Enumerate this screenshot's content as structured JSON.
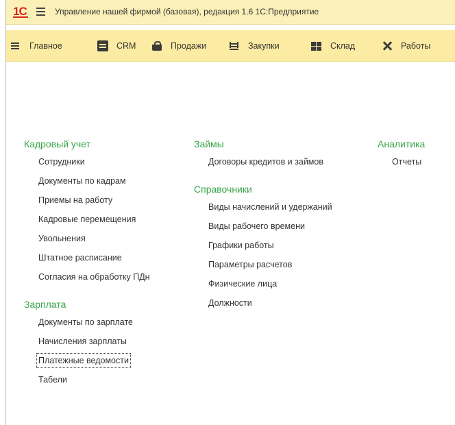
{
  "titlebar": {
    "logo": "1С",
    "title": "Управление нашей фирмой (базовая), редакция 1.6 1С:Предприятие"
  },
  "sections": [
    {
      "label": "Главное",
      "icon": "menu-icon"
    },
    {
      "label": "CRM",
      "icon": "crm-icon"
    },
    {
      "label": "Продажи",
      "icon": "basket-icon"
    },
    {
      "label": "Закупки",
      "icon": "truck-icon"
    },
    {
      "label": "Склад",
      "icon": "warehouse-icon"
    },
    {
      "label": "Работы",
      "icon": "tools-icon"
    }
  ],
  "columns": [
    {
      "groups": [
        {
          "title": "Кадровый учет",
          "items": [
            "Сотрудники",
            "Документы по кадрам",
            "Приемы на работу",
            "Кадровые перемещения",
            "Увольнения",
            "Штатное расписание",
            "Согласия на обработку ПДн"
          ]
        },
        {
          "title": "Зарплата",
          "items": [
            "Документы по зарплате",
            "Начисления зарплаты",
            "Платежные ведомости",
            "Табели"
          ]
        }
      ]
    },
    {
      "groups": [
        {
          "title": "Займы",
          "items": [
            "Договоры кредитов и займов"
          ]
        },
        {
          "title": "Справочники",
          "items": [
            "Виды начислений и удержаний",
            "Виды рабочего времени",
            "Графики работы",
            "Параметры расчетов",
            "Физические лица",
            "Должности"
          ]
        }
      ]
    },
    {
      "groups": [
        {
          "title": "Аналитика",
          "items": [
            "Отчеты"
          ]
        }
      ]
    }
  ],
  "focused_item": "Платежные ведомости",
  "colors": {
    "titlebar_bg": "#fbf0b8",
    "sections_bg": "#fbeba3",
    "group_title": "#3aa54a",
    "logo": "#d7241b"
  }
}
